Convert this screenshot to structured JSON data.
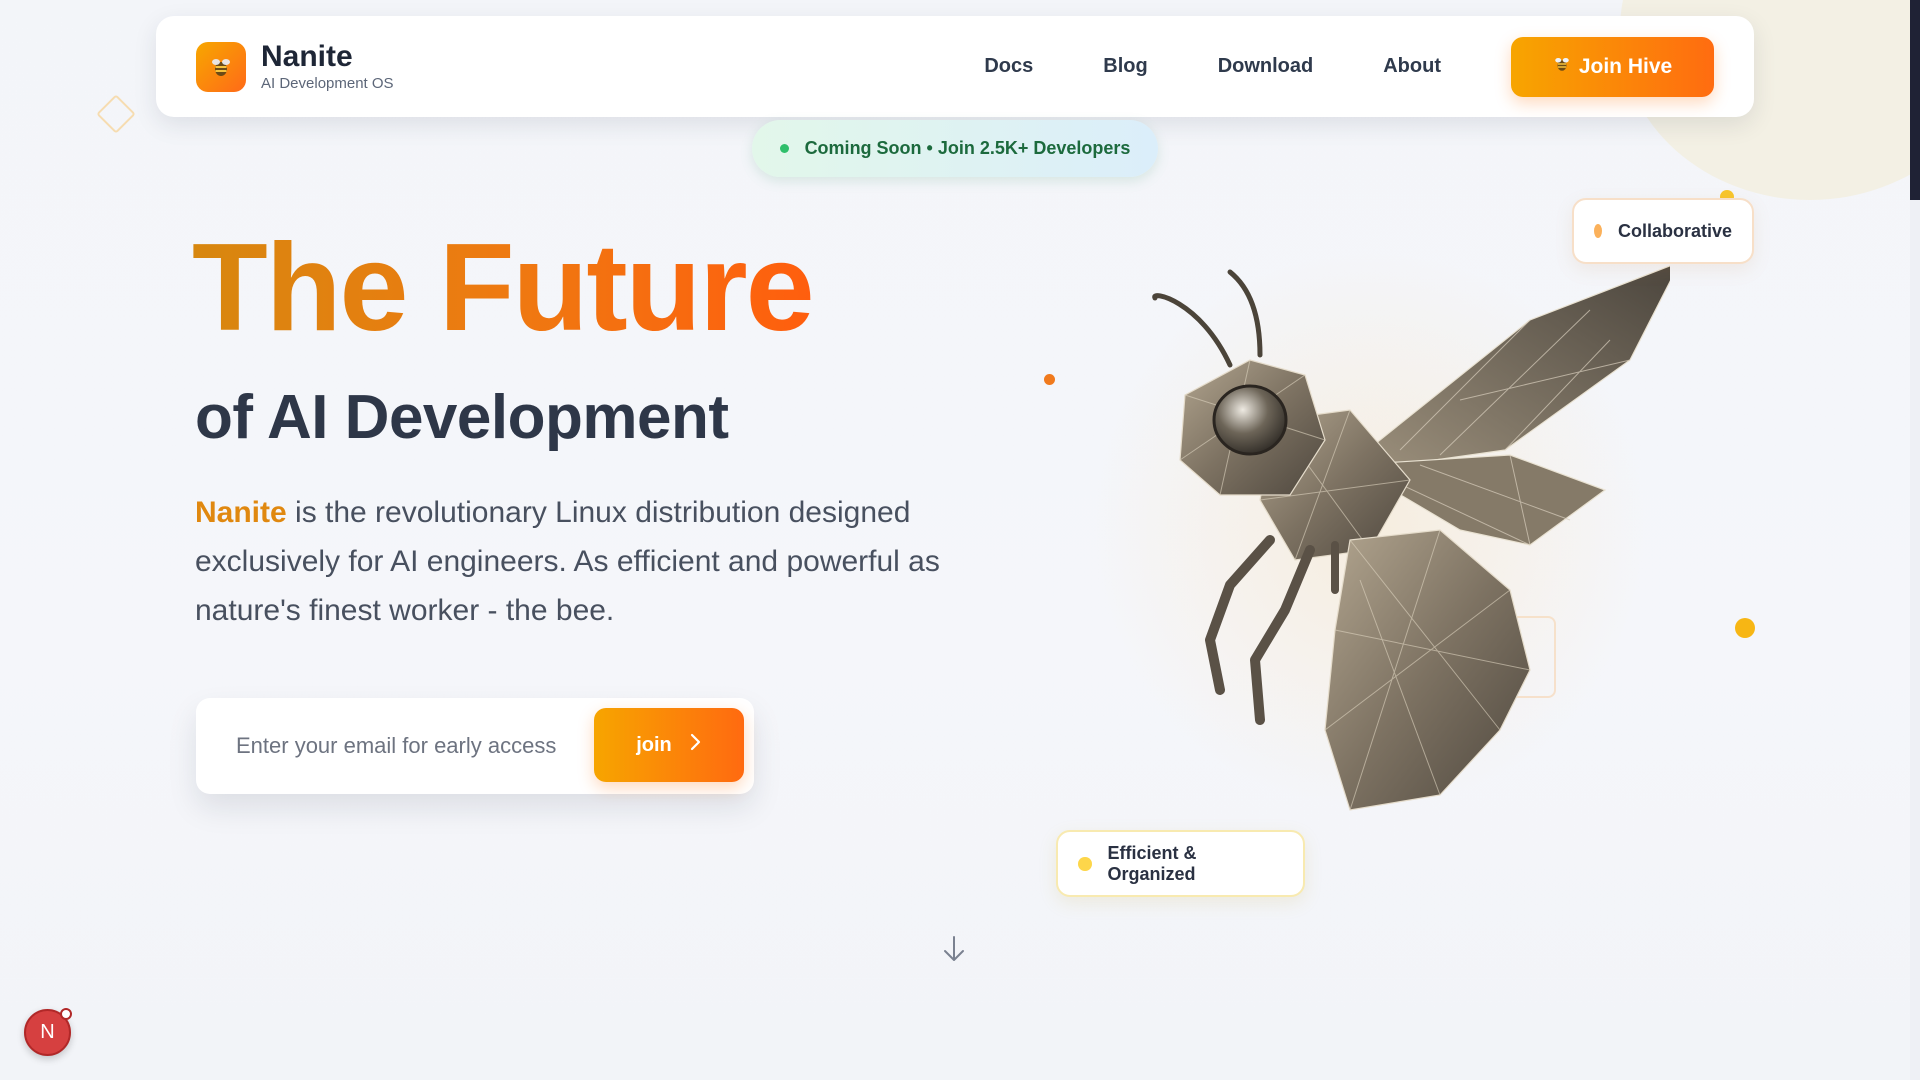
{
  "brand": {
    "name": "Nanite",
    "subtitle": "AI Development OS",
    "logo_icon": "bee-icon"
  },
  "nav": {
    "links": [
      "Docs",
      "Blog",
      "Download",
      "About"
    ],
    "cta_label": "Join Hive",
    "cta_icon": "bee-icon"
  },
  "badge": {
    "text": "Coming Soon • Join 2.5K+ Developers"
  },
  "hero": {
    "title": "The Future",
    "subtitle": "of AI Development",
    "description_brand": "Nanite",
    "description_rest": " is the revolutionary Linux distribution designed exclusively for AI engineers. As efficient and powerful as nature's finest worker - the bee."
  },
  "signup": {
    "placeholder": "Enter your email for early access",
    "button_label": "join"
  },
  "tags": {
    "collaborative": "Collaborative",
    "efficient": "Efficient & Organized"
  },
  "floating_badge": {
    "label": "N"
  },
  "colors": {
    "accent_start": "#f7a500",
    "accent_end": "#ff6a10",
    "heading": "#2e3748",
    "badge_text": "#1c6a3d"
  }
}
